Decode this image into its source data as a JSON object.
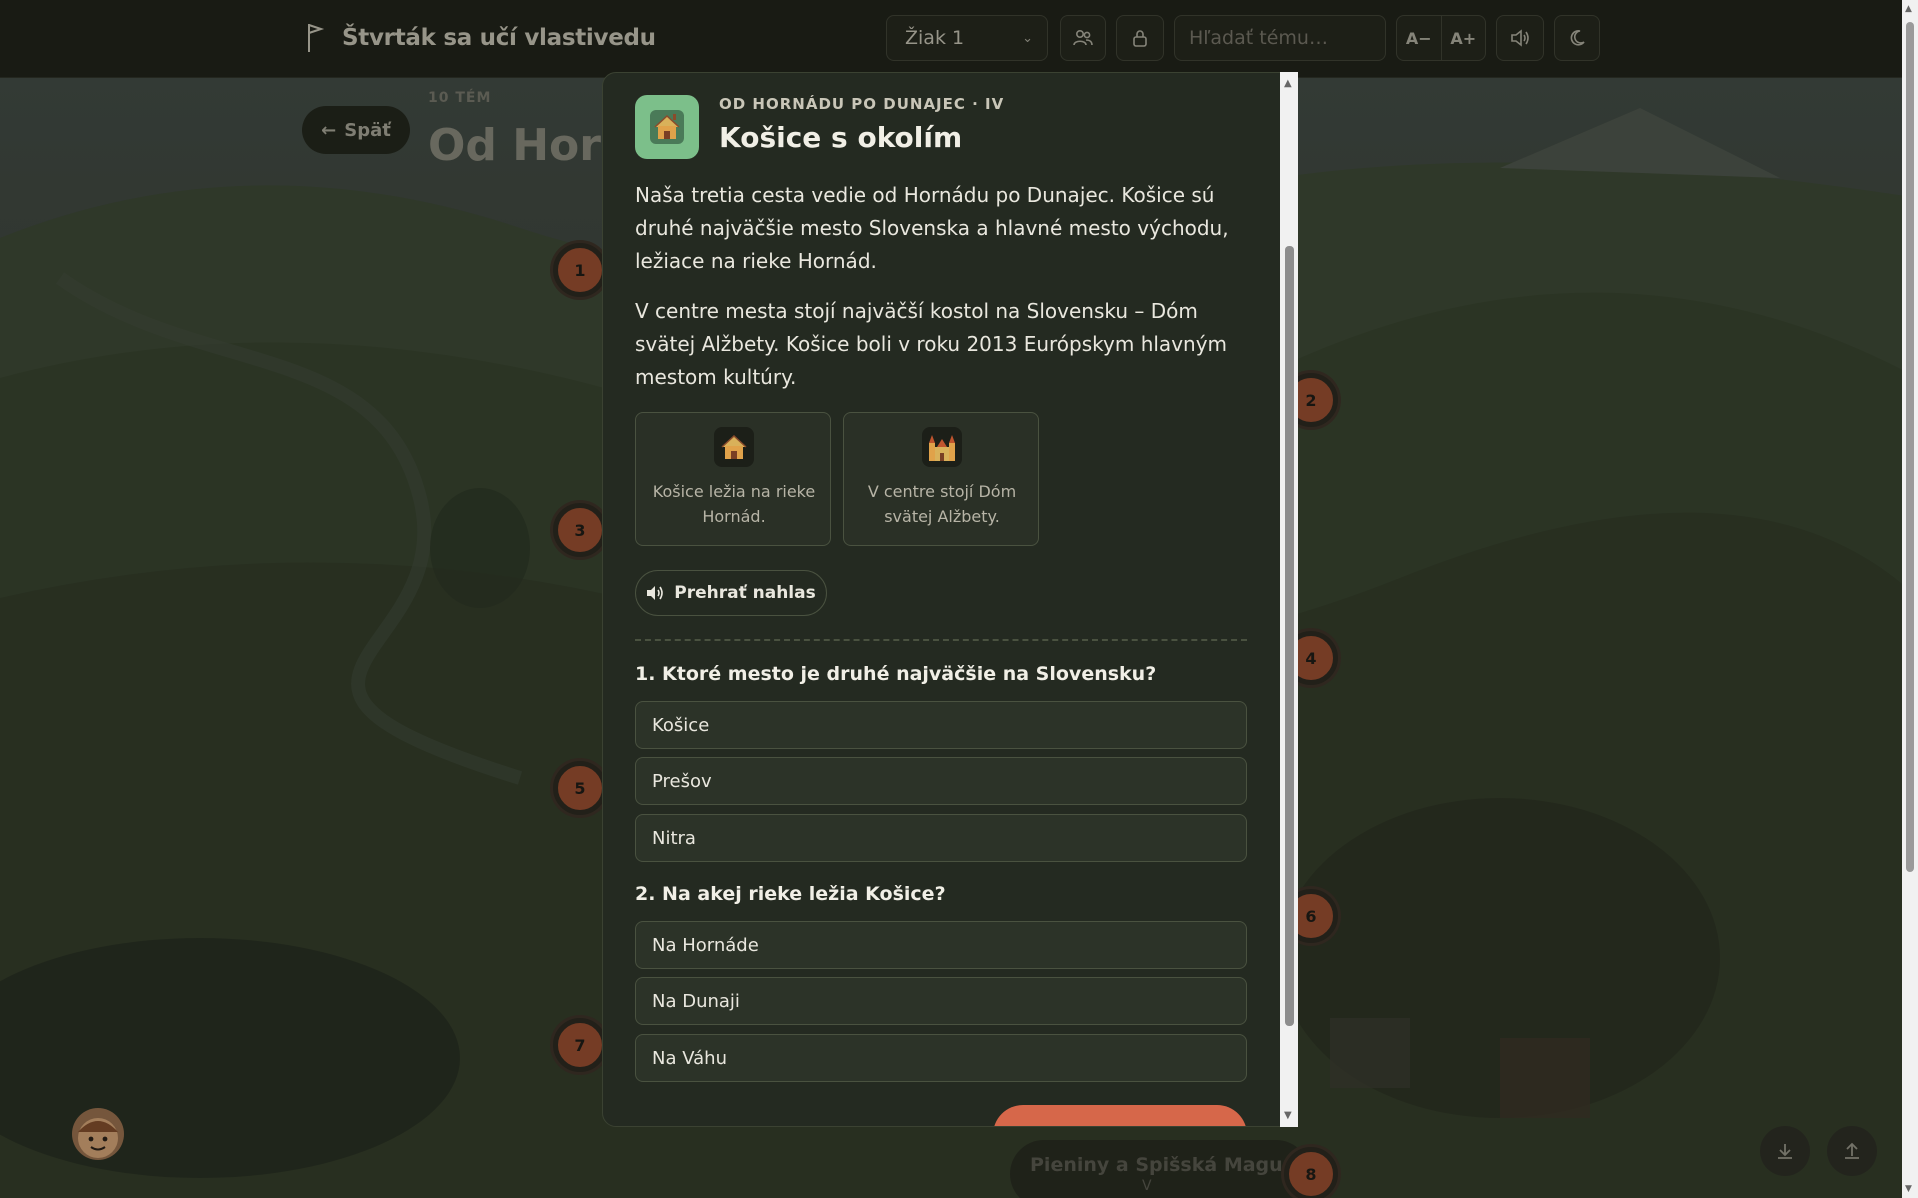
{
  "app": {
    "title": "Štvrták sa učí vlastivedu"
  },
  "toolbar": {
    "student_selected": "Žiak 1",
    "search_placeholder": "Hľadať tému…",
    "font_decrease": "A−",
    "font_increase": "A+"
  },
  "page": {
    "back_label": "Späť",
    "topic_count": "10 TÉM",
    "heading": "Od Horn",
    "route_nodes": [
      "1",
      "2",
      "3",
      "4",
      "5",
      "6",
      "7",
      "8"
    ],
    "node8_label": "Pieniny a Spišská Magura",
    "node8_sub": "V"
  },
  "modal": {
    "kicker": "OD HORNÁDU PO DUNAJEC · IV",
    "title": "Košice s okolím",
    "paragraphs": [
      "Naša tretia cesta vedie od Hornádu po Dunajec. Košice sú druhé najväčšie mesto Slovenska a hlavné mesto východu, ležiace na rieke Hornád.",
      "V centre mesta stojí najväčší kostol na Slovensku – Dóm svätej Alžbety. Košice boli v roku 2013 Európskym hlavným mestom kultúry."
    ],
    "facts": [
      {
        "icon": "house-icon",
        "text": "Košice ležia na rieke Hornád."
      },
      {
        "icon": "cathedral-icon",
        "text": "V centre stojí Dóm svätej Alžbety."
      }
    ],
    "play_label": "Prehrať nahlas",
    "quiz": [
      {
        "question": "1. Ktoré mesto je druhé najväčšie na Slovensku?",
        "options": [
          "Košice",
          "Prešov",
          "Nitra"
        ]
      },
      {
        "question": "2. Na akej rieke ležia Košice?",
        "options": [
          "Na Hornáde",
          "Na Dunaji",
          "Na Váhu"
        ]
      }
    ]
  },
  "colors": {
    "accent": "#d6674a",
    "icon_bg": "#7cbf8a",
    "node": "#8f4a2e",
    "modal_bg": "#242a21"
  }
}
